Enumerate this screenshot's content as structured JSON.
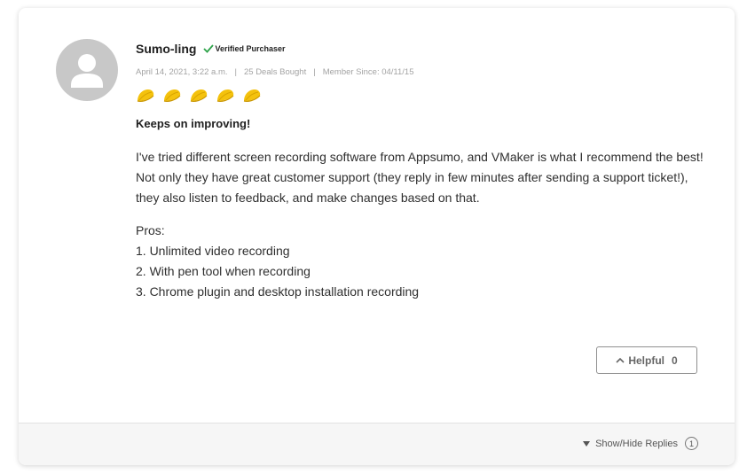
{
  "review": {
    "username": "Sumo-ling",
    "verified_label": "Verified Purchaser",
    "date": "April 14, 2021, 3:22 a.m.",
    "deals_bought": "25 Deals Bought",
    "member_since": "Member Since: 04/11/15",
    "meta_separator": "|",
    "rating": 5,
    "rating_max": 5,
    "title": "Keeps on improving!",
    "body": "I've tried different screen recording software from Appsumo, and VMaker is what I recommend the best! Not only they have great customer support (they reply in few minutes after sending a support ticket!), they also listen to feedback, and make changes based on that.",
    "pros_heading": "Pros:",
    "pros": [
      "1. Unlimited video recording",
      "2. With pen tool when recording",
      "3. Chrome plugin and desktop installation recording"
    ]
  },
  "actions": {
    "helpful_label": "Helpful",
    "helpful_count": "0"
  },
  "footer": {
    "replies_label": "Show/Hide Replies",
    "reply_count": "1"
  },
  "icons": {
    "avatar": "user-avatar-icon",
    "verified": "checkmark-icon",
    "rating": "taco-icon",
    "helpful": "chevron-up-icon",
    "replies": "triangle-down-icon"
  },
  "colors": {
    "taco": "#f4c20d",
    "verified_check": "#2ea34a",
    "avatar_bg": "#c8c8c8"
  }
}
